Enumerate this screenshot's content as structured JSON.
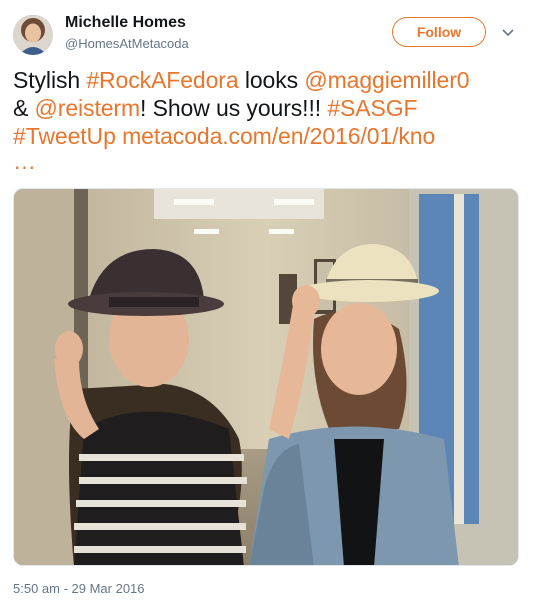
{
  "author": {
    "name": "Michelle Homes",
    "handle": "@HomesAtMetacoda"
  },
  "actions": {
    "follow_label": "Follow",
    "more_icon": "chevron-down-icon"
  },
  "tweet": {
    "parts": [
      {
        "text": "Stylish ",
        "type": "text"
      },
      {
        "text": "#RockAFedora",
        "type": "link"
      },
      {
        "text": " looks ",
        "type": "text"
      },
      {
        "text": "@maggiemiller0",
        "type": "link"
      },
      {
        "text": " & ",
        "type": "text"
      },
      {
        "text": "@reisterm",
        "type": "link"
      },
      {
        "text": "! Show us yours!!! ",
        "type": "text"
      },
      {
        "text": "#SASGF",
        "type": "link"
      },
      {
        "text": " ",
        "type": "text"
      },
      {
        "text": "#TweetUp",
        "type": "link"
      },
      {
        "text": " ",
        "type": "text"
      },
      {
        "text": "metacoda.com/en/2016/01/kno",
        "type": "link"
      }
    ],
    "ellipsis": "…",
    "timestamp": "5:50 am - 29 Mar 2016"
  },
  "colors": {
    "accent": "#e8762d",
    "text": "#14171a",
    "muted": "#657786"
  }
}
